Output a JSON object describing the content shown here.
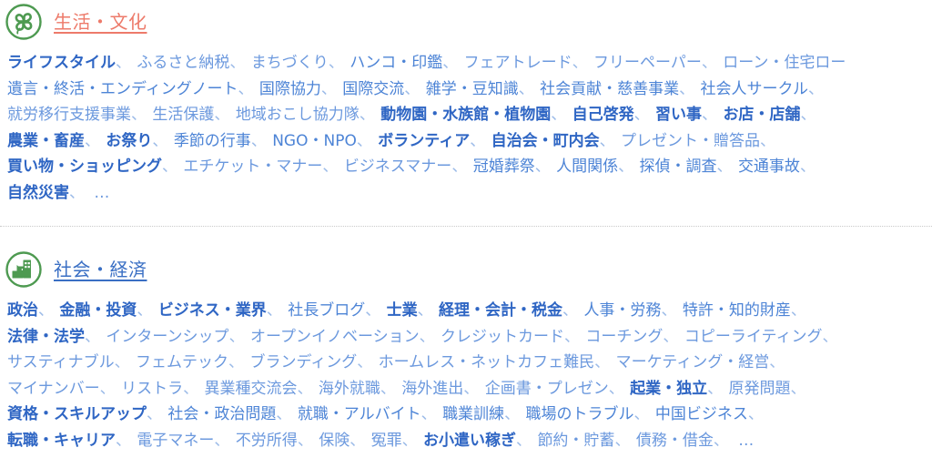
{
  "page": {
    "background": "#ffffff",
    "separator_char": "、",
    "ellipsis": "…"
  },
  "colors": {
    "title_life": "#ED7A6A",
    "title_society": "#3A6FC4",
    "tag_bold": "#2F66C4",
    "tag_normal": "#4D84D6",
    "tag_light": "#6C99DE",
    "separator": "#9CBBE8",
    "icon_green": "#4E9A51",
    "divider": "#C9C9C9"
  },
  "sections": [
    {
      "id": "life-culture",
      "icon": "clover-icon",
      "title": "生活・文化",
      "title_color": "#ED7A6A",
      "lines": [
        [
          {
            "t": "ライフスタイル",
            "w": "bold"
          },
          {
            "t": "ふるさと納税",
            "w": "light"
          },
          {
            "t": "まちづくり",
            "w": "light"
          },
          {
            "t": "ハンコ・印鑑",
            "w": "norm"
          },
          {
            "t": "フェアトレード",
            "w": "light"
          },
          {
            "t": "フリーペーパー",
            "w": "light"
          },
          {
            "t": "ローン・住宅ロー",
            "w": "light",
            "clipped": true
          }
        ],
        [
          {
            "t": "遺言・終活・エンディングノート",
            "w": "norm"
          },
          {
            "t": "国際協力",
            "w": "norm"
          },
          {
            "t": "国際交流",
            "w": "norm"
          },
          {
            "t": "雑学・豆知識",
            "w": "norm"
          },
          {
            "t": "社会貢献・慈善事業",
            "w": "norm"
          },
          {
            "t": "社会人サークル",
            "w": "norm"
          }
        ],
        [
          {
            "t": "就労移行支援事業",
            "w": "light"
          },
          {
            "t": "生活保護",
            "w": "light"
          },
          {
            "t": "地域おこし協力隊",
            "w": "light"
          },
          {
            "t": "動物園・水族館・植物園",
            "w": "bold"
          },
          {
            "t": "自己啓発",
            "w": "bold"
          },
          {
            "t": "習い事",
            "w": "bold"
          },
          {
            "t": "お店・店舗",
            "w": "bold"
          }
        ],
        [
          {
            "t": "農業・畜産",
            "w": "bold"
          },
          {
            "t": "お祭り",
            "w": "bold"
          },
          {
            "t": "季節の行事",
            "w": "norm"
          },
          {
            "t": "NGO・NPO",
            "w": "norm"
          },
          {
            "t": "ボランティア",
            "w": "bold"
          },
          {
            "t": "自治会・町内会",
            "w": "bold"
          },
          {
            "t": "プレゼント・贈答品",
            "w": "light"
          }
        ],
        [
          {
            "t": "買い物・ショッピング",
            "w": "bold"
          },
          {
            "t": "エチケット・マナー",
            "w": "light"
          },
          {
            "t": "ビジネスマナー",
            "w": "light"
          },
          {
            "t": "冠婚葬祭",
            "w": "norm"
          },
          {
            "t": "人間関係",
            "w": "norm"
          },
          {
            "t": "探偵・調査",
            "w": "norm"
          },
          {
            "t": "交通事故",
            "w": "norm"
          }
        ],
        [
          {
            "t": "自然災害",
            "w": "bold"
          },
          {
            "t": "…",
            "w": "ellipsis"
          }
        ]
      ]
    },
    {
      "id": "society-economy",
      "icon": "city-building-icon",
      "title": "社会・経済",
      "title_color": "#3A6FC4",
      "lines": [
        [
          {
            "t": "政治",
            "w": "bold"
          },
          {
            "t": "金融・投資",
            "w": "bold"
          },
          {
            "t": "ビジネス・業界",
            "w": "bold"
          },
          {
            "t": "社長ブログ",
            "w": "norm"
          },
          {
            "t": "士業",
            "w": "bold"
          },
          {
            "t": "経理・会計・税金",
            "w": "bold"
          },
          {
            "t": "人事・労務",
            "w": "norm"
          },
          {
            "t": "特許・知的財産",
            "w": "norm"
          }
        ],
        [
          {
            "t": "法律・法学",
            "w": "bold"
          },
          {
            "t": "インターンシップ",
            "w": "light"
          },
          {
            "t": "オープンイノベーション",
            "w": "light"
          },
          {
            "t": "クレジットカード",
            "w": "light"
          },
          {
            "t": "コーチング",
            "w": "light"
          },
          {
            "t": "コピーライティング",
            "w": "light"
          }
        ],
        [
          {
            "t": "サスティナブル",
            "w": "light"
          },
          {
            "t": "フェムテック",
            "w": "light"
          },
          {
            "t": "ブランディング",
            "w": "light"
          },
          {
            "t": "ホームレス・ネットカフェ難民",
            "w": "light"
          },
          {
            "t": "マーケティング・経営",
            "w": "light"
          }
        ],
        [
          {
            "t": "マイナンバー",
            "w": "light"
          },
          {
            "t": "リストラ",
            "w": "light"
          },
          {
            "t": "異業種交流会",
            "w": "light"
          },
          {
            "t": "海外就職",
            "w": "light"
          },
          {
            "t": "海外進出",
            "w": "light"
          },
          {
            "t": "企画書・プレゼン",
            "w": "light"
          },
          {
            "t": "起業・独立",
            "w": "bold"
          },
          {
            "t": "原発問題",
            "w": "light"
          }
        ],
        [
          {
            "t": "資格・スキルアップ",
            "w": "bold"
          },
          {
            "t": "社会・政治問題",
            "w": "norm"
          },
          {
            "t": "就職・アルバイト",
            "w": "norm"
          },
          {
            "t": "職業訓練",
            "w": "norm"
          },
          {
            "t": "職場のトラブル",
            "w": "norm"
          },
          {
            "t": "中国ビジネス",
            "w": "norm"
          }
        ],
        [
          {
            "t": "転職・キャリア",
            "w": "bold"
          },
          {
            "t": "電子マネー",
            "w": "light"
          },
          {
            "t": "不労所得",
            "w": "light"
          },
          {
            "t": "保険",
            "w": "light"
          },
          {
            "t": "冤罪",
            "w": "light"
          },
          {
            "t": "お小遣い稼ぎ",
            "w": "bold"
          },
          {
            "t": "節約・貯蓄",
            "w": "light"
          },
          {
            "t": "債務・借金",
            "w": "light"
          },
          {
            "t": "…",
            "w": "ellipsis"
          }
        ]
      ]
    }
  ]
}
